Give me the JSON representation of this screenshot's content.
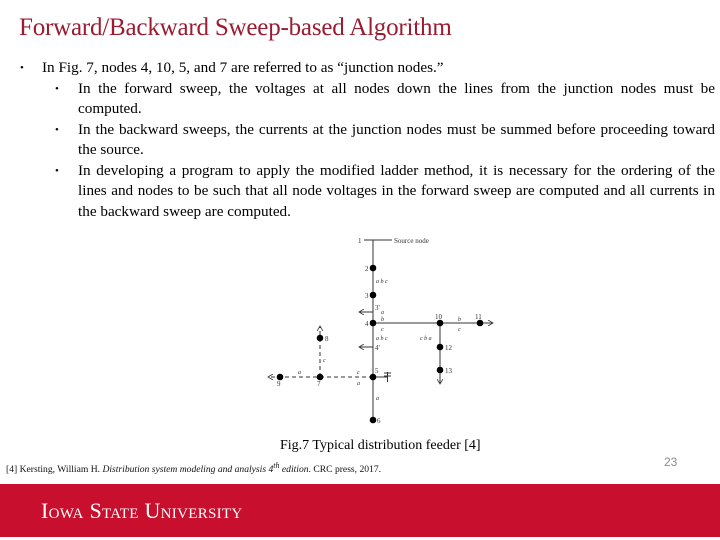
{
  "slide": {
    "title": "Forward/Backward Sweep-based Algorithm",
    "page_number": "23",
    "accent_color": "#9b1b30",
    "footer_color": "#c8102e"
  },
  "bullets": {
    "main": "In Fig. 7, nodes 4, 10, 5, and 7 are referred to as “junction nodes.”",
    "sub": [
      "In the forward sweep, the voltages at all nodes down the lines from the junction nodes must be computed.",
      "In the backward sweeps, the currents at the junction nodes must be summed before proceeding toward the source.",
      "In developing a program to apply the modified ladder method, it is necessary for the ordering of the lines and nodes to be such that all node voltages in the forward sweep are computed and all currents in the backward sweep are computed."
    ]
  },
  "figure": {
    "caption": "Fig.7 Typical distribution feeder [4]",
    "source_label": "Source node",
    "nodes": [
      "1",
      "2",
      "3",
      "3'",
      "4",
      "4'",
      "5",
      "6",
      "7",
      "8",
      "9",
      "10",
      "11",
      "12",
      "13"
    ],
    "phase_labels": {
      "seg_2_3": "a b c",
      "seg_4_5": "a b c",
      "seg_10_12": "c b a",
      "seg_4_10_top": "a",
      "seg_4_10_mid": "b",
      "seg_4_10_bot": "c",
      "seg_10_11_top": "b",
      "seg_10_11_bot": "c",
      "seg_5_7_top": "c",
      "seg_5_7_bot": "a",
      "seg_7_9": "a",
      "seg_7_8": "c",
      "seg_5_6": "a"
    }
  },
  "reference": {
    "prefix": "[4] Kersting, William H. ",
    "title_italic": "Distribution system modeling and analysis 4",
    "sup": "th",
    "edition_italic": " edition",
    "suffix": ". CRC press, 2017."
  },
  "footer": {
    "logo_text": "Iowa State University"
  }
}
